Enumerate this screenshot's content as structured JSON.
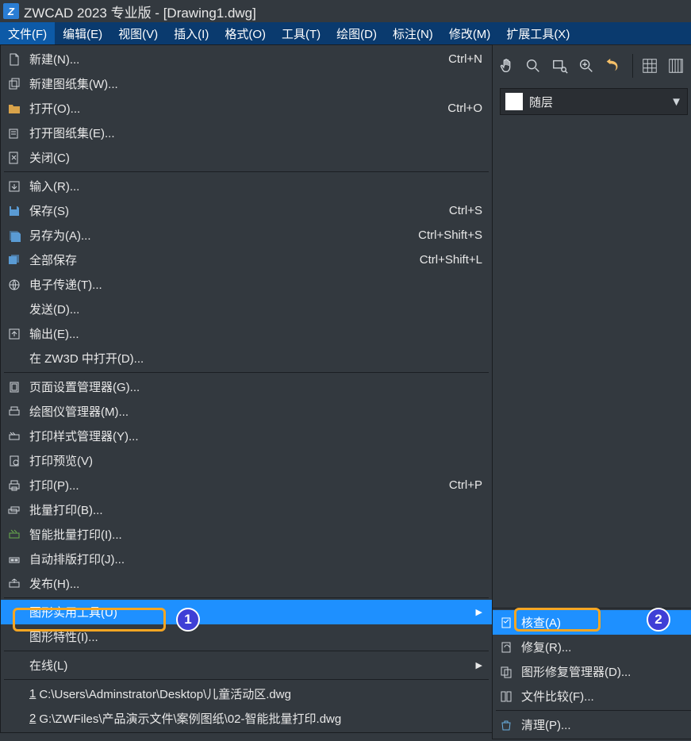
{
  "titlebar": {
    "app": "ZWCAD 2023 专业版 - [Drawing1.dwg]"
  },
  "menubar": {
    "items": [
      {
        "label": "文件(F)"
      },
      {
        "label": "编辑(E)"
      },
      {
        "label": "视图(V)"
      },
      {
        "label": "插入(I)"
      },
      {
        "label": "格式(O)"
      },
      {
        "label": "工具(T)"
      },
      {
        "label": "绘图(D)"
      },
      {
        "label": "标注(N)"
      },
      {
        "label": "修改(M)"
      },
      {
        "label": "扩展工具(X)"
      }
    ]
  },
  "layer_dropdown": {
    "label": "随层"
  },
  "file_menu": {
    "g1": [
      {
        "label": "新建(N)...",
        "sc": "Ctrl+N",
        "ul": "N"
      },
      {
        "label": "新建图纸集(W)...",
        "ul": "W"
      },
      {
        "label": "打开(O)...",
        "sc": "Ctrl+O",
        "ul": "O"
      },
      {
        "label": "打开图纸集(E)...",
        "ul": "E"
      },
      {
        "label": "关闭(C)",
        "ul": "C"
      }
    ],
    "g2": [
      {
        "label": "输入(R)...",
        "ul": "R"
      },
      {
        "label": "保存(S)",
        "sc": "Ctrl+S",
        "ul": "S"
      },
      {
        "label": "另存为(A)...",
        "sc": "Ctrl+Shift+S",
        "ul": "A"
      },
      {
        "label": "全部保存",
        "sc": "Ctrl+Shift+L"
      },
      {
        "label": "电子传递(T)...",
        "ul": "T"
      },
      {
        "label": "发送(D)...",
        "ul": "D"
      },
      {
        "label": "输出(E)...",
        "ul": "E"
      },
      {
        "label": "在 ZW3D 中打开(D)...",
        "ul": "D"
      }
    ],
    "g3": [
      {
        "label": "页面设置管理器(G)...",
        "ul": "G"
      },
      {
        "label": "绘图仪管理器(M)...",
        "ul": "M"
      },
      {
        "label": "打印样式管理器(Y)...",
        "ul": "Y"
      },
      {
        "label": "打印预览(V)",
        "ul": "V"
      },
      {
        "label": "打印(P)...",
        "sc": "Ctrl+P",
        "ul": "P"
      },
      {
        "label": "批量打印(B)...",
        "ul": "B"
      },
      {
        "label": "智能批量打印(I)...",
        "ul": "I"
      },
      {
        "label": "自动排版打印(J)...",
        "ul": "J"
      },
      {
        "label": "发布(H)...",
        "ul": "H"
      }
    ],
    "g4": [
      {
        "label": "图形实用工具(U)",
        "ul": "U",
        "arrow": true,
        "selected": true
      },
      {
        "label": "图形特性(I)...",
        "ul": "I"
      }
    ],
    "g5": [
      {
        "label": "在线(L)",
        "ul": "L",
        "arrow": true
      }
    ],
    "recent": [
      {
        "n": "1",
        "path": "C:\\Users\\Adminstrator\\Desktop\\儿童活动区.dwg"
      },
      {
        "n": "2",
        "path": "G:\\ZWFiles\\产品演示文件\\案例图纸\\02-智能批量打印.dwg"
      }
    ]
  },
  "submenu": {
    "items": [
      {
        "label": "核查(A)",
        "ul": "A",
        "selected": true
      },
      {
        "label": "修复(R)...",
        "ul": "R"
      },
      {
        "label": "图形修复管理器(D)...",
        "ul": "D"
      },
      {
        "label": "文件比较(F)...",
        "ul": "F"
      }
    ],
    "items2": [
      {
        "label": "清理(P)...",
        "ul": "P"
      }
    ]
  },
  "annotations": {
    "b1": "1",
    "b2": "2"
  }
}
